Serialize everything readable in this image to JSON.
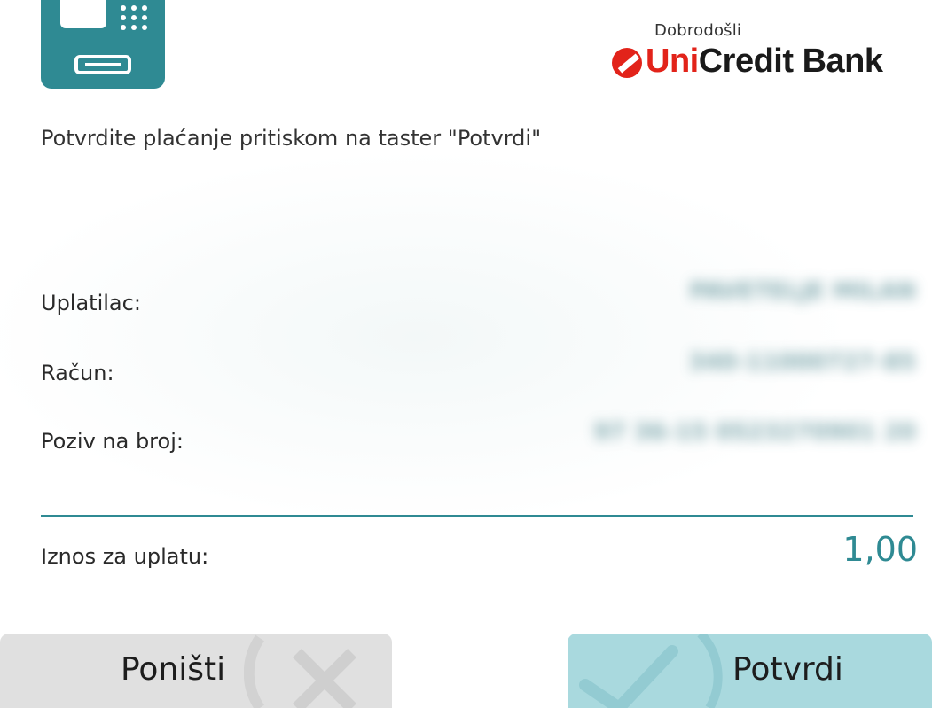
{
  "header": {
    "welcome": "Dobrodošli",
    "brand_prefix": "Uni",
    "brand_suffix": "Credit Bank"
  },
  "instruction": "Potvrdite plaćanje pritiskom na taster \"Potvrdi\"",
  "fields": {
    "payer_label": "Uplatilac:",
    "payer_value": "PAVETELJE MILAN",
    "account_label": "Račun:",
    "account_value": "340-11000727-85",
    "reference_label": "Poziv na broj:",
    "reference_value": "97 36-15 0523270901 20"
  },
  "amount": {
    "label": "Iznos za uplatu:",
    "value": "1,00"
  },
  "buttons": {
    "cancel": "Poništi",
    "confirm": "Potvrdi"
  },
  "colors": {
    "teal": "#2f8a93",
    "brand_red": "#e2231a",
    "cancel_bg": "#e0e0e0",
    "confirm_bg": "#a9d9de"
  },
  "icons": [
    "atm-icon",
    "unicredit-logo-icon",
    "x-icon",
    "check-icon"
  ]
}
